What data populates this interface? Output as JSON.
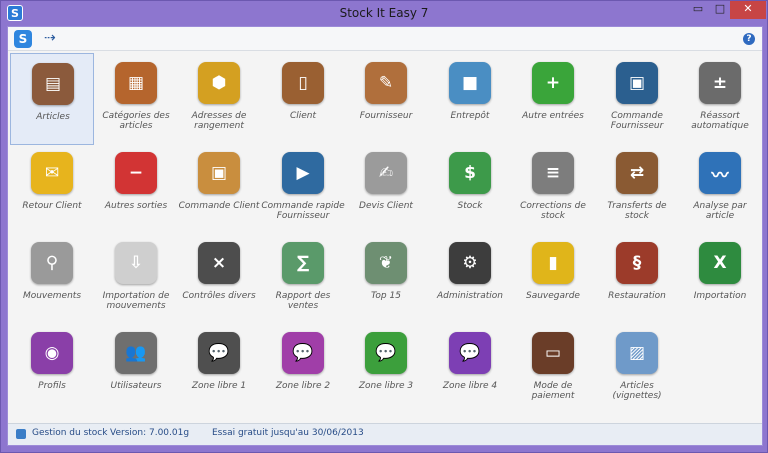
{
  "window": {
    "title": "Stock It Easy 7",
    "app_badge": "S",
    "min_glyph": "▭",
    "max_glyph": "□",
    "close_glyph": "✕"
  },
  "toolbar": {
    "logo": "S",
    "arrow": "⇢",
    "help": "?"
  },
  "tiles": [
    {
      "label": "Articles",
      "icon": "address-book-icon",
      "color": "#8b5a3c",
      "glyph": "▤",
      "selected": true
    },
    {
      "label": "Catégories des articles",
      "icon": "wooden-crate-icon",
      "color": "#b5652d",
      "glyph": "▦"
    },
    {
      "label": "Adresses de rangement",
      "icon": "honeycomb-icon",
      "color": "#d4a021",
      "glyph": "⬢"
    },
    {
      "label": "Client",
      "icon": "contacts-book-icon",
      "color": "#9a6032",
      "glyph": "▯"
    },
    {
      "label": "Fournisseur",
      "icon": "book-pen-icon",
      "color": "#b06f3c",
      "glyph": "✎"
    },
    {
      "label": "Entrepôt",
      "icon": "boxes-icon",
      "color": "#4a8ec3",
      "glyph": "■"
    },
    {
      "label": "Autre entrées",
      "icon": "calendar-plus-icon",
      "color": "#3aa53a",
      "glyph": "+"
    },
    {
      "label": "Commande Fournisseur",
      "icon": "package-icon",
      "color": "#2b5f8f",
      "glyph": "▣"
    },
    {
      "label": "Réassort automatique",
      "icon": "calculator-icon",
      "color": "#6b6b6b",
      "glyph": "±"
    },
    {
      "label": "Retour Client",
      "icon": "envelope-icon",
      "color": "#e7b41d",
      "glyph": "✉"
    },
    {
      "label": "Autres sorties",
      "icon": "calendar-minus-icon",
      "color": "#d23434",
      "glyph": "−"
    },
    {
      "label": "Commande Client",
      "icon": "box-icon",
      "color": "#c98e3e",
      "glyph": "▣"
    },
    {
      "label": "Commande rapide Fournisseur",
      "icon": "clapperboard-icon",
      "color": "#2f6aa0",
      "glyph": "▶"
    },
    {
      "label": "Devis Client",
      "icon": "quote-pen-icon",
      "color": "#9b9b9b",
      "glyph": "✍"
    },
    {
      "label": "Stock",
      "icon": "dollar-sheet-icon",
      "color": "#3d9a4a",
      "glyph": "$"
    },
    {
      "label": "Corrections de stock",
      "icon": "toggles-icon",
      "color": "#7d7d7d",
      "glyph": "≡"
    },
    {
      "label": "Transferts de stock",
      "icon": "transfer-icon",
      "color": "#8a5a33",
      "glyph": "⇄"
    },
    {
      "label": "Analyse par article",
      "icon": "line-chart-icon",
      "color": "#2f72b8",
      "glyph": "〰"
    },
    {
      "label": "Mouvements",
      "icon": "magnifier-icon",
      "color": "#9a9a9a",
      "glyph": "⚲"
    },
    {
      "label": "Importation de mouvements",
      "icon": "import-tray-icon",
      "color": "#cfcfcf",
      "glyph": "⇩"
    },
    {
      "label": "Contrôles divers",
      "icon": "calculator-keys-icon",
      "color": "#4d4d4d",
      "glyph": "×"
    },
    {
      "label": "Rapport des ventes",
      "icon": "chalkboard-icon",
      "color": "#5a9a6a",
      "glyph": "∑"
    },
    {
      "label": "Top 15",
      "icon": "laurel-chalkboard-icon",
      "color": "#6e8f72",
      "glyph": "❦"
    },
    {
      "label": "Administration",
      "icon": "gears-panel-icon",
      "color": "#3d3d3d",
      "glyph": "⚙"
    },
    {
      "label": "Sauvegarde",
      "icon": "notebook-icon",
      "color": "#e0b51a",
      "glyph": "▮"
    },
    {
      "label": "Restauration",
      "icon": "spring-icon",
      "color": "#9c3b2a",
      "glyph": "§"
    },
    {
      "label": "Importation",
      "icon": "excel-icon",
      "color": "#2e8b3f",
      "glyph": "X"
    },
    {
      "label": "Profils",
      "icon": "podcast-icon",
      "color": "#8a3fa8",
      "glyph": "◉"
    },
    {
      "label": "Utilisateurs",
      "icon": "users-icon",
      "color": "#6f6f6f",
      "glyph": "👥"
    },
    {
      "label": "Zone libre 1",
      "icon": "speech-bubble-dark-icon",
      "color": "#4f4f4f",
      "glyph": "💬"
    },
    {
      "label": "Zone libre 2",
      "icon": "speech-bubble-purple-icon",
      "color": "#a03ea8",
      "glyph": "💬"
    },
    {
      "label": "Zone libre 3",
      "icon": "speech-bubble-green-icon",
      "color": "#3c9f3c",
      "glyph": "💬"
    },
    {
      "label": "Zone libre 4",
      "icon": "speech-bubble-violet-icon",
      "color": "#7d3fb4",
      "glyph": "💬"
    },
    {
      "label": "Mode de paiement",
      "icon": "wallet-cards-icon",
      "color": "#6a3d28",
      "glyph": "▭"
    },
    {
      "label": "Articles (vignettes)",
      "icon": "photo-icon",
      "color": "#6f9ac9",
      "glyph": "▨"
    }
  ],
  "status": {
    "mode": "Gestion du stock",
    "version": "Version: 7.00.01g",
    "trial": "Essai gratuit jusqu'au 30/06/2013"
  }
}
